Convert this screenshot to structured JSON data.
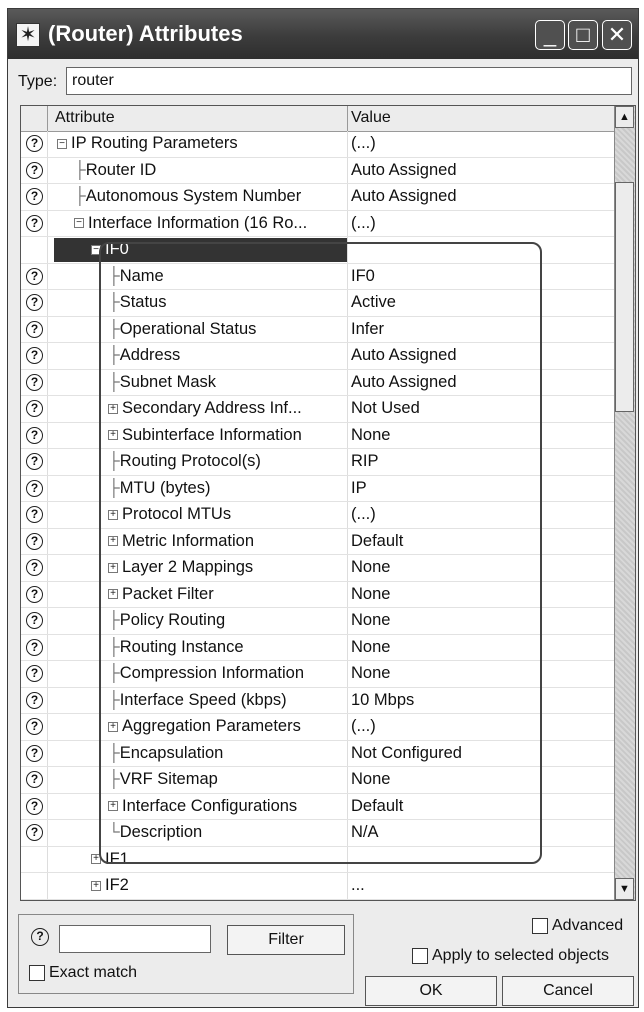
{
  "window": {
    "title": "(Router) Attributes",
    "app_icon": "asterisk-icon",
    "minimize_glyph": "_",
    "maximize_glyph": "□",
    "close_glyph": "✕"
  },
  "type_row": {
    "label": "Type:",
    "value": "router"
  },
  "table": {
    "col_attribute": "Attribute",
    "col_value": "Value",
    "help_glyph": "?",
    "rows": [
      {
        "attr": "IP Routing Parameters",
        "value": "(...)",
        "indent": 1,
        "expander": "minus",
        "help": true
      },
      {
        "attr": "Router ID",
        "value": "Auto Assigned",
        "indent": 2,
        "expander": "line",
        "help": true
      },
      {
        "attr": "Autonomous System Number",
        "value": "Auto Assigned",
        "indent": 2,
        "expander": "line",
        "help": true
      },
      {
        "attr": "Interface Information (16 Ro...",
        "value": "(...)",
        "indent": 2,
        "expander": "minus",
        "help": true
      },
      {
        "attr": "IF0",
        "value": "",
        "indent": 3,
        "expander": "minus",
        "help": false,
        "selected": true
      },
      {
        "attr": "Name",
        "value": "IF0",
        "indent": 4,
        "expander": "line",
        "help": true
      },
      {
        "attr": "Status",
        "value": "Active",
        "indent": 4,
        "expander": "line",
        "help": true
      },
      {
        "attr": "Operational Status",
        "value": "Infer",
        "indent": 4,
        "expander": "line",
        "help": true
      },
      {
        "attr": "Address",
        "value": "Auto Assigned",
        "indent": 4,
        "expander": "line",
        "help": true
      },
      {
        "attr": "Subnet Mask",
        "value": "Auto Assigned",
        "indent": 4,
        "expander": "line",
        "help": true
      },
      {
        "attr": "Secondary Address Inf...",
        "value": "Not Used",
        "indent": 4,
        "expander": "plus",
        "help": true
      },
      {
        "attr": "Subinterface Information",
        "value": "None",
        "indent": 4,
        "expander": "plus",
        "help": true
      },
      {
        "attr": "Routing Protocol(s)",
        "value": "RIP",
        "indent": 4,
        "expander": "line",
        "help": true
      },
      {
        "attr": "MTU (bytes)",
        "value": "IP",
        "indent": 4,
        "expander": "line",
        "help": true
      },
      {
        "attr": "Protocol MTUs",
        "value": "(...)",
        "indent": 4,
        "expander": "plus",
        "help": true
      },
      {
        "attr": "Metric Information",
        "value": "Default",
        "indent": 4,
        "expander": "plus",
        "help": true
      },
      {
        "attr": "Layer 2 Mappings",
        "value": "None",
        "indent": 4,
        "expander": "plus",
        "help": true
      },
      {
        "attr": "Packet Filter",
        "value": "None",
        "indent": 4,
        "expander": "plus",
        "help": true
      },
      {
        "attr": "Policy Routing",
        "value": "None",
        "indent": 4,
        "expander": "line",
        "help": true
      },
      {
        "attr": "Routing Instance",
        "value": "None",
        "indent": 4,
        "expander": "line",
        "help": true
      },
      {
        "attr": "Compression Information",
        "value": "None",
        "indent": 4,
        "expander": "line",
        "help": true
      },
      {
        "attr": "Interface Speed (kbps)",
        "value": "10 Mbps",
        "indent": 4,
        "expander": "line",
        "help": true
      },
      {
        "attr": "Aggregation Parameters",
        "value": "(...)",
        "indent": 4,
        "expander": "plus",
        "help": true
      },
      {
        "attr": "Encapsulation",
        "value": "Not Configured",
        "indent": 4,
        "expander": "line",
        "help": true
      },
      {
        "attr": "VRF Sitemap",
        "value": "None",
        "indent": 4,
        "expander": "line",
        "help": true
      },
      {
        "attr": "Interface Configurations",
        "value": "Default",
        "indent": 4,
        "expander": "plus",
        "help": true
      },
      {
        "attr": "Description",
        "value": "N/A",
        "indent": 4,
        "expander": "last",
        "help": true
      },
      {
        "attr": "IF1",
        "value": "...",
        "indent": 3,
        "expander": "plus",
        "help": false
      },
      {
        "attr": "IF2",
        "value": "...",
        "indent": 3,
        "expander": "plus",
        "help": false
      }
    ]
  },
  "bottom": {
    "help_glyph": "?",
    "filter_input_value": "",
    "filter_button": "Filter",
    "exact_match_label": "Exact match",
    "advanced_label": "Advanced",
    "apply_label": "Apply to selected objects",
    "ok_button": "OK",
    "cancel_button": "Cancel"
  }
}
